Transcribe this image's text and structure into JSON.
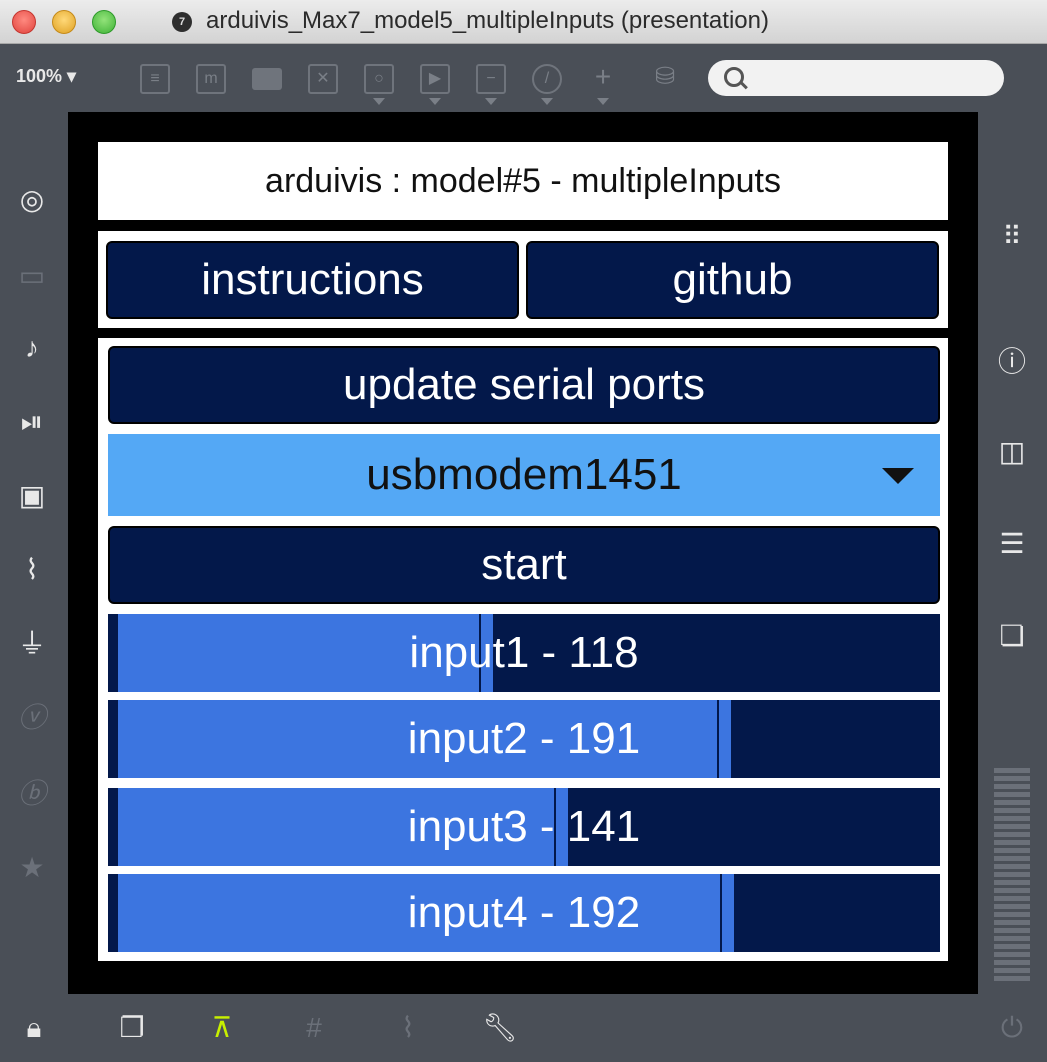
{
  "window": {
    "title": "arduivis_Max7_model5_multipleInputs (presentation)",
    "doc_icon": "7"
  },
  "toolbar": {
    "zoom": "100%",
    "search_placeholder": ""
  },
  "patch": {
    "title": "arduivis : model#5 - multipleInputs",
    "instructions_label": "instructions",
    "github_label": "github",
    "update_label": "update serial ports",
    "port_selected": "usbmodem1451",
    "start_label": "start",
    "sliders": [
      {
        "label": "input1 - 118",
        "value": 118,
        "max": 255
      },
      {
        "label": "input2 - 191",
        "value": 191,
        "max": 255
      },
      {
        "label": "input3 - 141",
        "value": 141,
        "max": 255
      },
      {
        "label": "input4 - 192",
        "value": 192,
        "max": 255
      }
    ]
  },
  "colors": {
    "button": "#03184a",
    "dropdown": "#54a8f5",
    "slider_fill": "#3c75e0",
    "present_mode": "#c8f000"
  }
}
